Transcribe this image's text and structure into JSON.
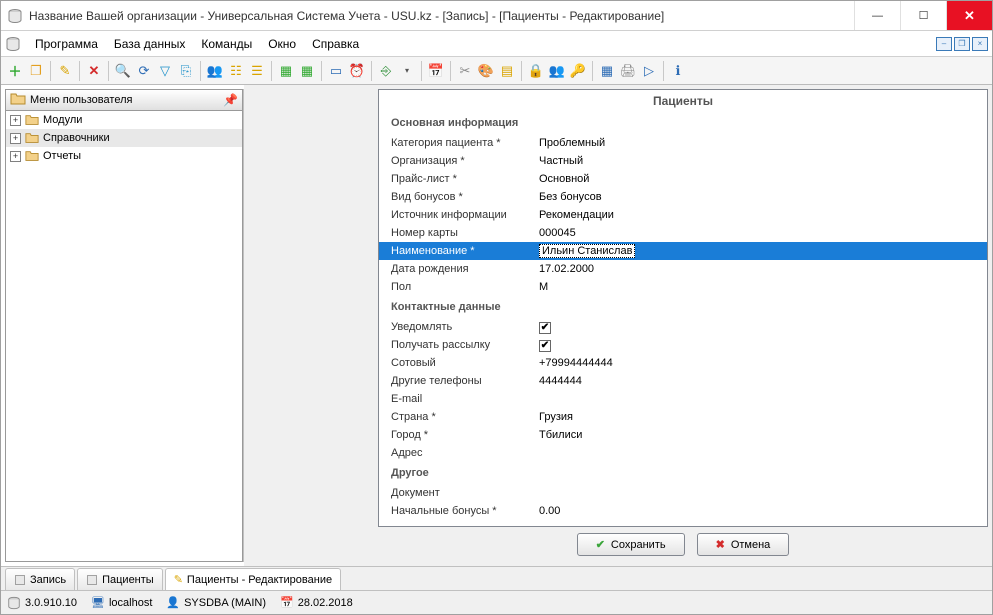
{
  "title": "Название Вашей организации - Универсальная Система Учета - USU.kz - [Запись] - [Пациенты - Редактирование]",
  "menu": {
    "program": "Программа",
    "database": "База данных",
    "commands": "Команды",
    "window": "Окно",
    "help": "Справка"
  },
  "sidebar": {
    "title": "Меню пользователя",
    "items": [
      "Модули",
      "Справочники",
      "Отчеты"
    ]
  },
  "form": {
    "header": "Пациенты",
    "sections": {
      "main": "Основная информация",
      "contact": "Контактные данные",
      "other": "Другое"
    },
    "rows": {
      "category": {
        "label": "Категория пациента *",
        "value": "Проблемный"
      },
      "org": {
        "label": "Организация *",
        "value": "Частный"
      },
      "price": {
        "label": "Прайс-лист *",
        "value": "Основной"
      },
      "bonus": {
        "label": "Вид бонусов *",
        "value": "Без бонусов"
      },
      "source": {
        "label": "Источник информации",
        "value": "Рекомендации"
      },
      "card": {
        "label": "Номер карты",
        "value": "000045"
      },
      "name": {
        "label": "Наименование *",
        "value": "Ильин Станислав"
      },
      "dob": {
        "label": "Дата рождения",
        "value": "17.02.2000"
      },
      "sex": {
        "label": "Пол",
        "value": "М"
      },
      "notify": {
        "label": "Уведомлять",
        "checked": true
      },
      "subscribe": {
        "label": "Получать рассылку",
        "checked": true
      },
      "mobile": {
        "label": "Сотовый",
        "value": "+79994444444"
      },
      "phones": {
        "label": "Другие телефоны",
        "value": "4444444"
      },
      "email": {
        "label": "E-mail",
        "value": ""
      },
      "country": {
        "label": "Страна *",
        "value": "Грузия"
      },
      "city": {
        "label": "Город *",
        "value": "Тбилиси"
      },
      "address": {
        "label": "Адрес",
        "value": ""
      },
      "document": {
        "label": "Документ",
        "value": ""
      },
      "start_bonus": {
        "label": "Начальные бонусы *",
        "value": "0.00"
      }
    }
  },
  "buttons": {
    "save": "Сохранить",
    "cancel": "Отмена"
  },
  "tabs": {
    "t1": "Запись",
    "t2": "Пациенты",
    "t3": "Пациенты - Редактирование"
  },
  "status": {
    "version": "3.0.910.10",
    "host": "localhost",
    "user": "SYSDBA (MAIN)",
    "date": "28.02.2018"
  }
}
